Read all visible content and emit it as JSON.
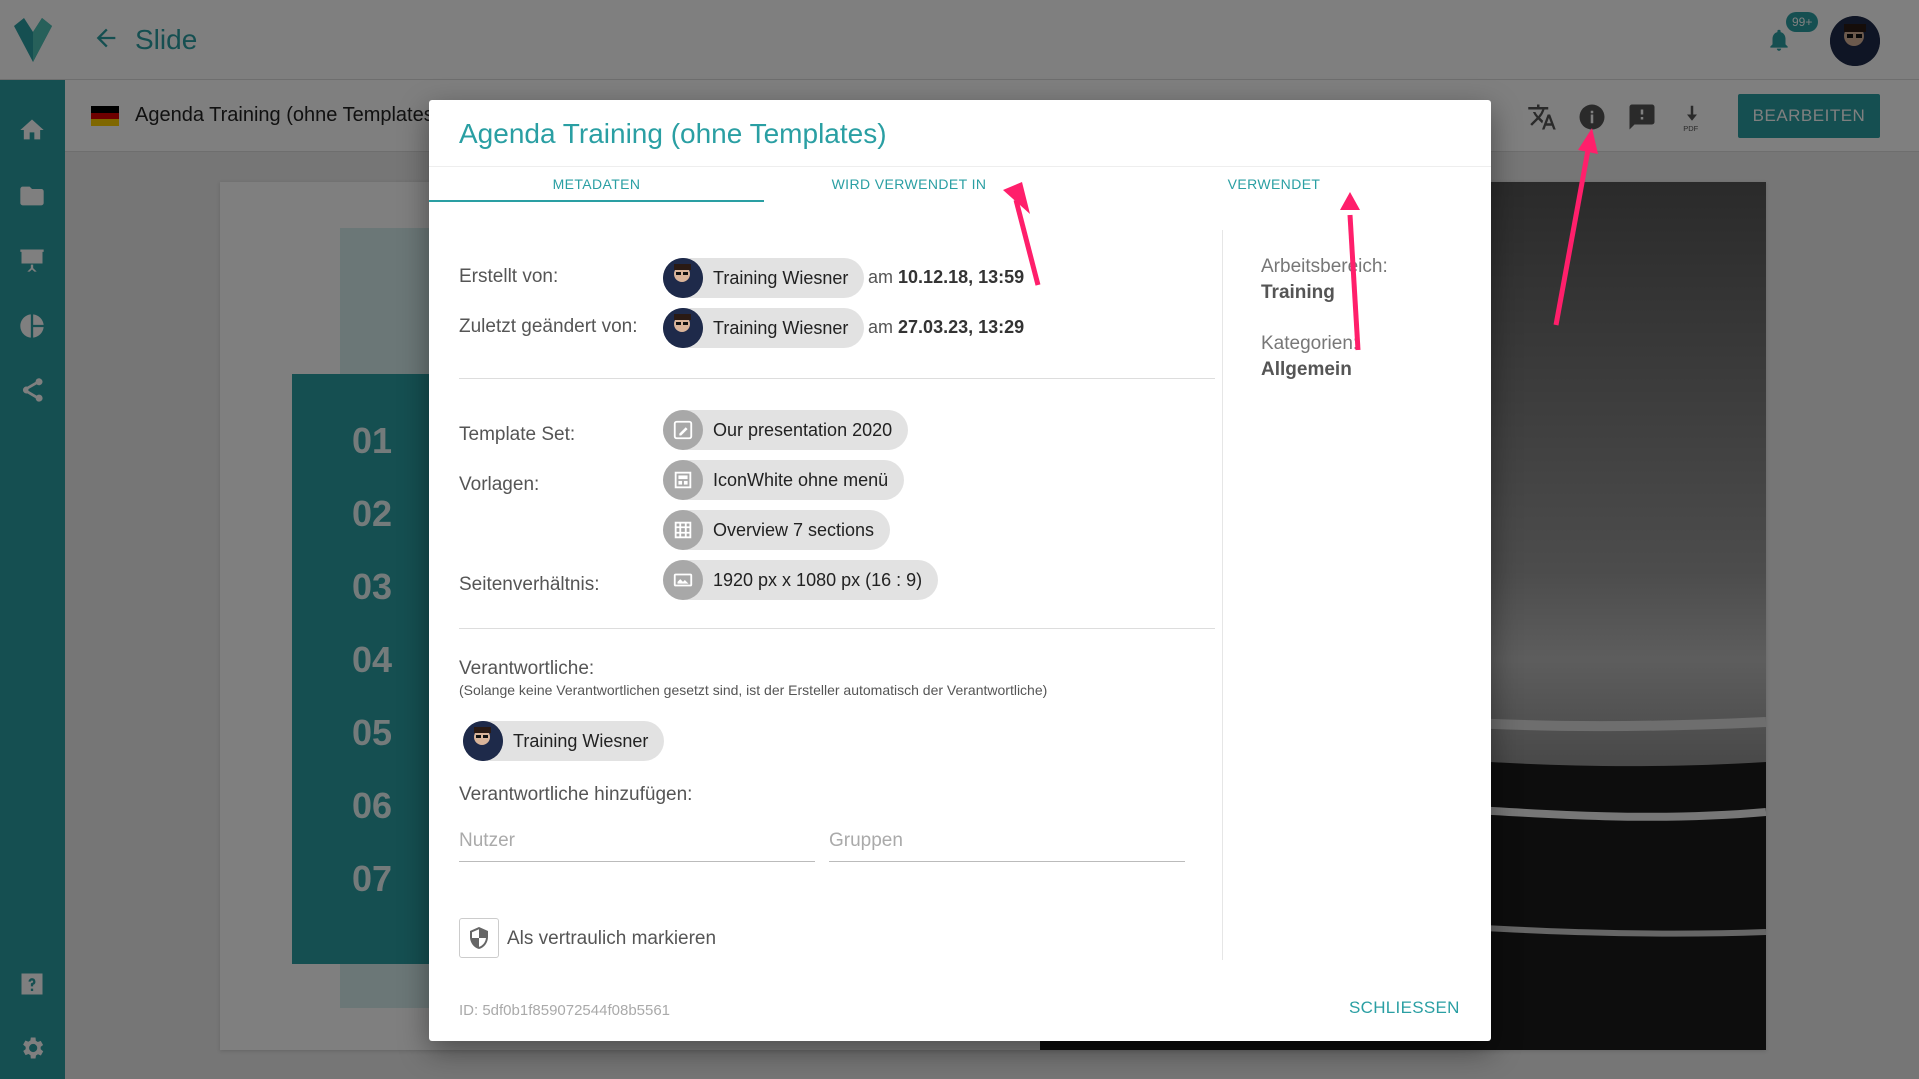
{
  "app": {
    "title": "Slide",
    "notification_badge": "99+"
  },
  "subheader": {
    "doc_title": "Agenda Training (ohne Templates)",
    "edit_label": "BEARBEITEN"
  },
  "slide": {
    "numbers": [
      "01",
      "02",
      "03",
      "04",
      "05",
      "06",
      "07"
    ]
  },
  "modal": {
    "title": "Agenda Training (ohne Templates)",
    "tabs": [
      "METADATEN",
      "WIRD VERWENDET IN",
      "VERWENDET"
    ],
    "created_by_label": "Erstellt von:",
    "created_by_user": "Training Wiesner",
    "created_prefix": "am",
    "created_date": "10.12.18, 13:59",
    "modified_by_label": "Zuletzt geändert von:",
    "modified_by_user": "Training Wiesner",
    "modified_prefix": "am",
    "modified_date": "27.03.23, 13:29",
    "template_set_label": "Template Set:",
    "template_set": "Our presentation 2020",
    "templates_label": "Vorlagen:",
    "templates": [
      "IconWhite ohne menü",
      "Overview 7 sections"
    ],
    "aspect_label": "Seitenverhältnis:",
    "aspect_value": "1920 px x 1080 px (16 : 9)",
    "responsible_label": "Verantwortliche:",
    "responsible_note": "(Solange keine Verantwortlichen gesetzt sind, ist der Ersteller automatisch der Verantwortliche)",
    "responsible_user": "Training Wiesner",
    "add_responsible_label": "Verantwortliche hinzufügen:",
    "user_placeholder": "Nutzer",
    "group_placeholder": "Gruppen",
    "confidential_label": "Als vertraulich markieren",
    "workspace_label": "Arbeitsbereich:",
    "workspace_value": "Training",
    "category_label": "Kategorien:",
    "category_value": "Allgemein",
    "id_text": "ID: 5df0b1f859072544f08b5561",
    "close_label": "SCHLIESSEN"
  },
  "colors": {
    "accent": "#2a9fa3",
    "annotation": "#ff1f6b"
  },
  "icons": [
    "logo-icon",
    "back-arrow-icon",
    "bell-icon",
    "home-icon",
    "folder-icon",
    "presentation-icon",
    "pie-chart-icon",
    "share-icon",
    "help-icon",
    "settings-icon",
    "translate-icon",
    "info-icon",
    "feedback-icon",
    "pdf-download-icon",
    "shield-icon"
  ]
}
